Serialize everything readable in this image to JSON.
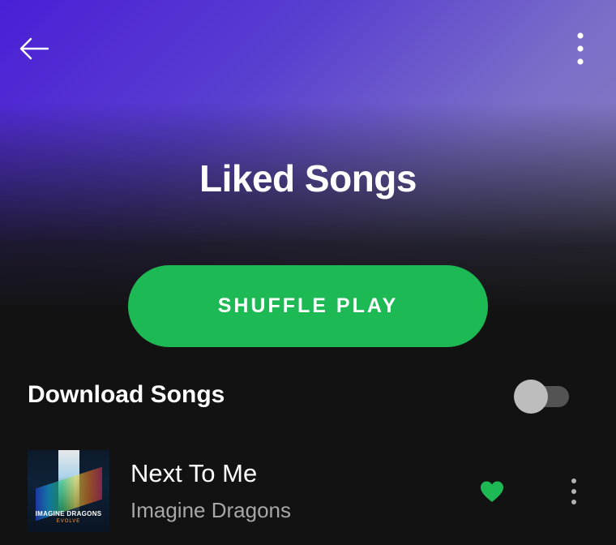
{
  "header": {
    "back_icon": "arrow-left-icon",
    "more_icon": "vertical-dots-icon",
    "title": "Liked Songs"
  },
  "actions": {
    "shuffle_label": "SHUFFLE PLAY"
  },
  "download": {
    "label": "Download Songs",
    "enabled": false
  },
  "tracks": [
    {
      "title": "Next To Me",
      "artist": "Imagine Dragons",
      "album_art_text": "IMAGINE DRAGONS",
      "album_art_subtext": "EVOLVE",
      "liked": true,
      "heart_icon": "heart-filled-icon",
      "more_icon": "vertical-dots-icon"
    }
  ],
  "colors": {
    "accent": "#1db954",
    "background": "#121212",
    "gradient_top": "#4a1fd6",
    "secondary_text": "#a7a7a7"
  }
}
